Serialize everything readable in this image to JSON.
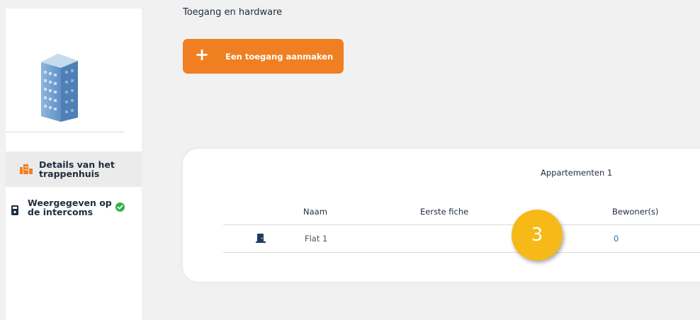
{
  "sidebar": {
    "nav": [
      {
        "label": "Details van het trappenhuis",
        "icon": "staircase-icon",
        "active": true
      },
      {
        "label": "Weergegeven op de intercoms",
        "icon": "intercom-icon",
        "status_icon": "check-circle-icon"
      }
    ]
  },
  "page": {
    "heading": "Toegang en hardware",
    "create_button": {
      "plus": "+",
      "label": "Een toegang aanmaken"
    }
  },
  "table": {
    "title": "Appartementen 1",
    "columns": [
      "Naam",
      "Eerste fiche",
      "Bewoner(s)"
    ],
    "rows": [
      {
        "icon": "door-icon",
        "naam": "Flat 1",
        "eerste_fiche": "",
        "bewoners": "0"
      }
    ]
  },
  "badge": {
    "label": "3"
  },
  "colors": {
    "accent": "#f07f22",
    "badge": "#f6b917",
    "link": "#2b6cb0",
    "check": "#2fb344"
  }
}
